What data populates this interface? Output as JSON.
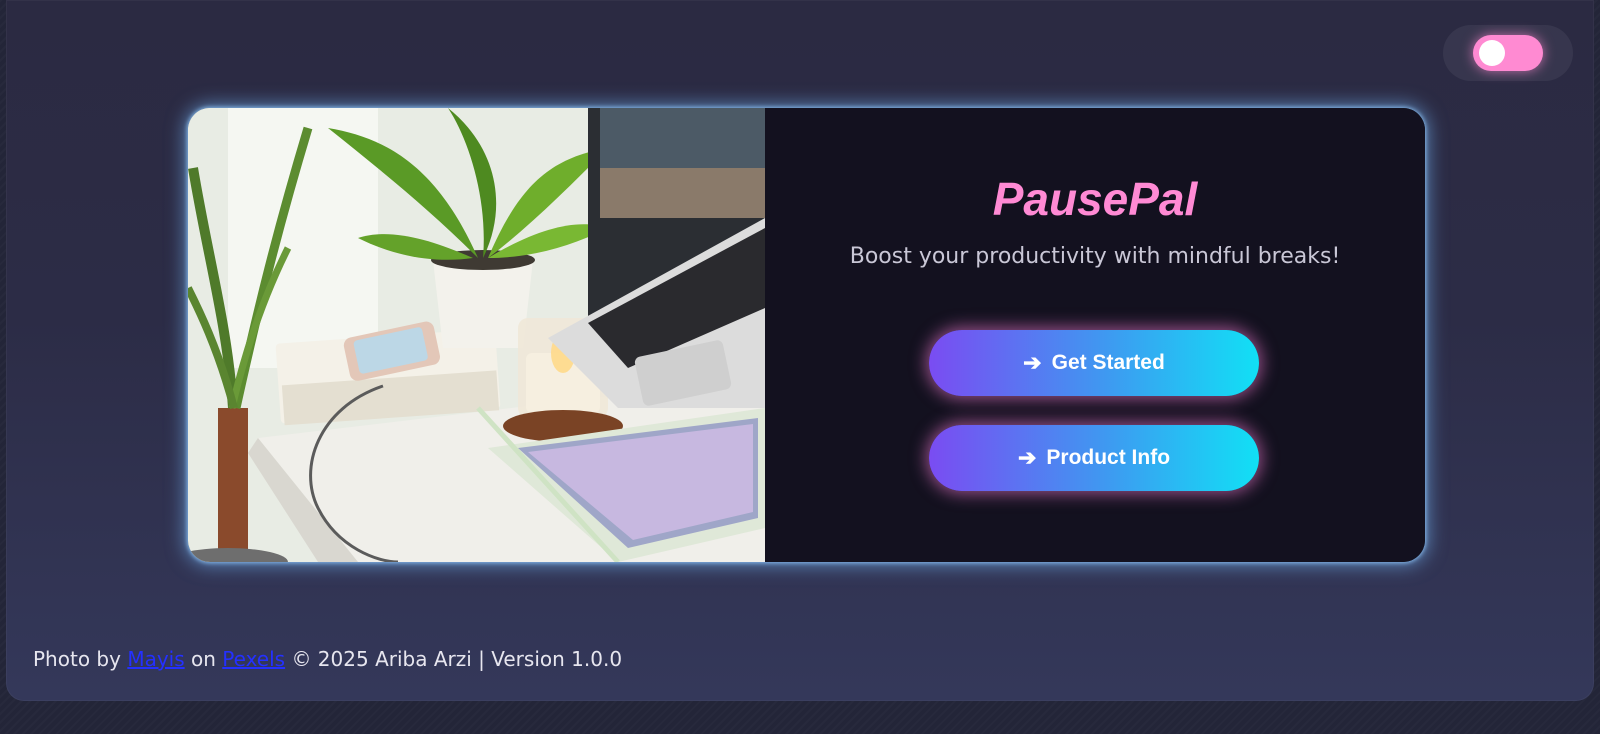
{
  "app": {
    "title": "PausePal",
    "tagline": "Boost your productivity with mindful breaks!"
  },
  "theme_toggle": {
    "state": "on",
    "color": "#ff8ad2"
  },
  "buttons": {
    "get_started": {
      "icon": "➔",
      "label": "Get Started"
    },
    "product_info": {
      "icon": "➔",
      "label": "Product Info"
    }
  },
  "footer": {
    "prefix": "Photo by",
    "photographer_link": "Mayis",
    "middle": "on",
    "site_link": "Pexels",
    "suffix": "© 2025 Ariba Arzi | Version 1.0.0"
  },
  "colors": {
    "title_pink": "#ff8ad4",
    "button_gradient_start": "#7a4cf2",
    "button_gradient_end": "#11e0f5",
    "card_glow": "#78beff"
  }
}
